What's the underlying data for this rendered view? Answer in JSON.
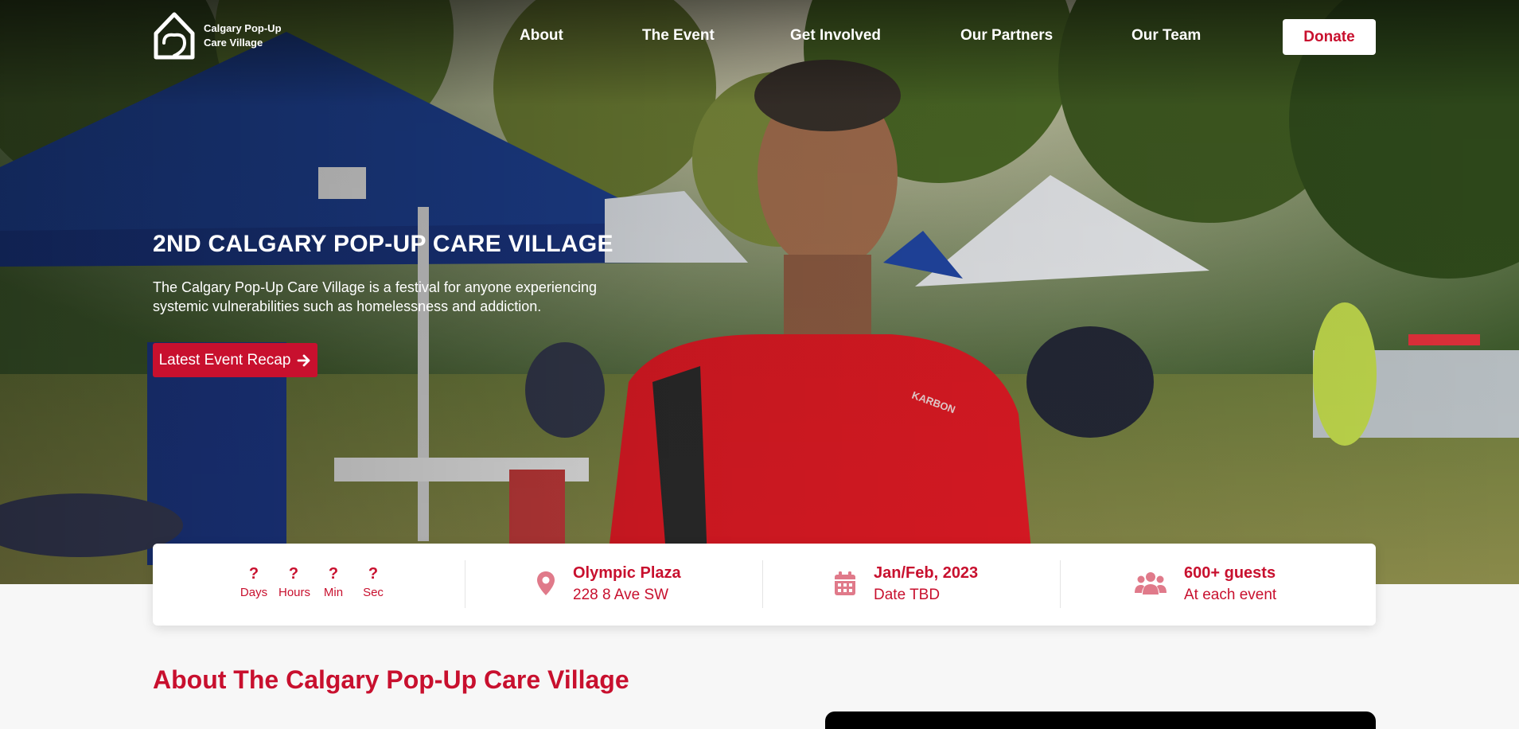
{
  "logo": {
    "line1": "Calgary Pop-Up",
    "line2": "Care Village"
  },
  "nav": {
    "links": [
      "About",
      "The Event",
      "Get Involved",
      "Our Partners",
      "Our Team"
    ],
    "donate_label": "Donate"
  },
  "hero": {
    "title": "2ND CALGARY POP-UP CARE VILLAGE",
    "description": "The Calgary Pop-Up Care Village is a festival for anyone experiencing systemic vulnerabilities such as homelessness and addiction.",
    "recap_label": "Latest Event Recap"
  },
  "countdown": [
    {
      "value": "?",
      "label": "Days"
    },
    {
      "value": "?",
      "label": "Hours"
    },
    {
      "value": "?",
      "label": "Min"
    },
    {
      "value": "?",
      "label": "Sec"
    }
  ],
  "info": {
    "location": {
      "title": "Olympic Plaza",
      "subtitle": "228 8 Ave SW",
      "icon": "map-pin-icon"
    },
    "date": {
      "title": "Jan/Feb, 2023",
      "subtitle": "Date TBD",
      "icon": "calendar-icon"
    },
    "guests": {
      "title": "600+ guests",
      "subtitle": "At each event",
      "icon": "users-icon"
    }
  },
  "about": {
    "title": "About The Calgary Pop-Up Care Village"
  },
  "colors": {
    "brand_red": "#c8102e",
    "icon_pink": "#e07a8a",
    "white": "#ffffff"
  }
}
